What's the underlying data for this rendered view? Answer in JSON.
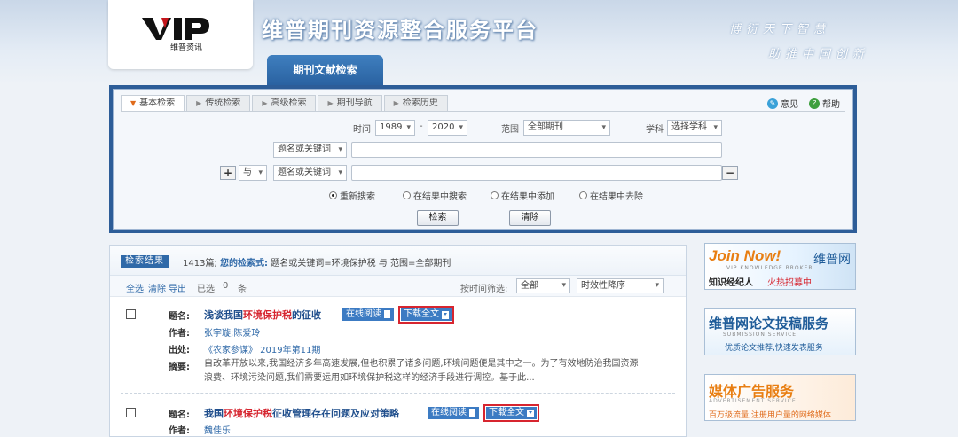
{
  "header": {
    "logo_sub": "维普资讯",
    "site_title": "维普期刊资源整合服务平台",
    "slogan_1": "博衍天下智慧",
    "slogan_2": "助推中国创新",
    "main_tab": "期刊文献检索"
  },
  "search": {
    "subtabs": [
      "基本检索",
      "传统检索",
      "高级检索",
      "期刊导航",
      "检索历史"
    ],
    "help": {
      "feedback": "意见",
      "help": "帮助"
    },
    "time_label": "时间",
    "year_from": "1989",
    "dash": "-",
    "year_to": "2020",
    "range_label": "范围",
    "range_value": "全部期刊",
    "subject_label": "学科",
    "subject_value": "选择学科",
    "field1": "题名或关键词",
    "plus": "+",
    "logic": "与",
    "field2": "题名或关键词",
    "minus": "−",
    "radios": [
      "重新搜索",
      "在结果中搜索",
      "在结果中添加",
      "在结果中去除"
    ],
    "search_btn": "检索",
    "clear_btn": "清除"
  },
  "results": {
    "badge": "检索结果",
    "count_text": "1413篇;",
    "query_label": "您的检索式:",
    "query_text": "题名或关键词=环境保护税 与 范围=全部期刊",
    "tools": {
      "select_all": "全选",
      "clear": "清除",
      "export": "导出",
      "selected": "已选",
      "selected_count": "0",
      "unit": "条"
    },
    "filter_label": "按时间筛选:",
    "filter_value": "全部",
    "sort_value": "时效性降序",
    "labels": {
      "title": "题名:",
      "author": "作者:",
      "source": "出处:",
      "abstract": "摘要:"
    },
    "online_read": "在线阅读",
    "download": "下载全文",
    "items": [
      {
        "title_pre": "浅谈我国",
        "title_hl": "环境保护税",
        "title_post": "的征收",
        "authors": "张宇璇;陈爱玲",
        "source": "《农家参谋》 2019年第11期",
        "abstract_1": "自改革开放以来,我国经济多年高速发展,但也积累了诸多问题,环境问题便是其中之一。为了有效地防治我国资源",
        "abstract_2": "浪费、环境污染问题,我们需要运用如环境保护税这样的经济手段进行调控。基于此..."
      },
      {
        "title_pre": "我国",
        "title_hl": "环境保护税",
        "title_post": "征收管理存在问题及应对策略",
        "authors": "魏佳乐"
      }
    ]
  },
  "ads": {
    "ad1_title": "Join Now!",
    "ad1_brand": "维普网",
    "ad1_en": "VIP KNOWLEDGE BROKER",
    "ad1_sub": "知识经纪人",
    "ad1_sub2": "火热招募中",
    "ad2_title": "维普网论文投稿服务",
    "ad2_en": "SUBMISSION SERVICE",
    "ad2_sub": "优质论文推荐,快速发表服务",
    "ad3_title": "媒体广告服务",
    "ad3_en": "ADVERTISEMENT SERVICE",
    "ad3_sub": "百万级流量,注册用户量的网络媒体"
  }
}
